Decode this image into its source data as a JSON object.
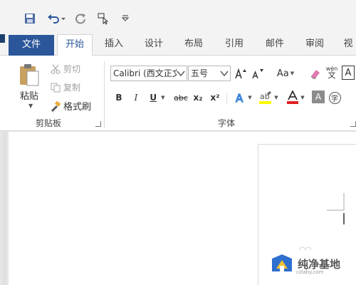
{
  "tabs": {
    "file": "文件",
    "home": "开始",
    "insert": "插入",
    "design": "设计",
    "layout": "布局",
    "references": "引用",
    "mailings": "邮件",
    "review": "审阅",
    "view": "视"
  },
  "clipboard": {
    "paste": "粘贴",
    "cut": "剪切",
    "copy": "复制",
    "format_painter": "格式刷",
    "group_label": "剪贴板"
  },
  "font": {
    "font_name": "Calibri (西文正文",
    "font_size": "五号",
    "change_case": "Aa",
    "phonetic_top": "wén",
    "phonetic_bottom": "文",
    "border_char": "A",
    "bold": "B",
    "italic": "I",
    "underline": "U",
    "strikethrough": "abc",
    "subscript": "x₂",
    "superscript": "x²",
    "shading_char": "A",
    "enclose_char": "字",
    "group_label": "字体"
  },
  "watermark": {
    "text": "纯净基地",
    "sub": "czlaby.com"
  },
  "colors": {
    "brand": "#2b579a",
    "highlight": "#ffff00",
    "font_color": "#e02020"
  }
}
